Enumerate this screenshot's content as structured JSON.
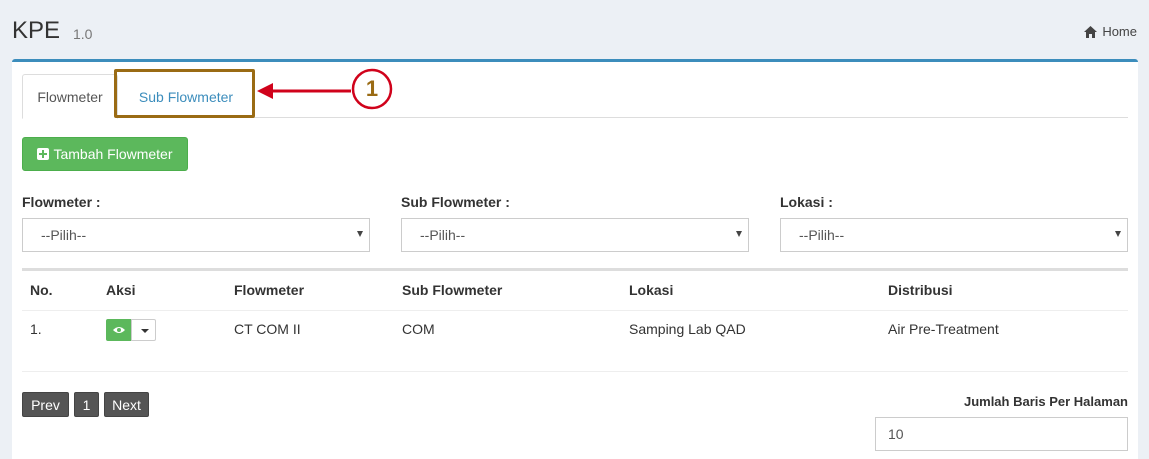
{
  "header": {
    "brand": "KPE",
    "version": "1.0",
    "home_label": "Home"
  },
  "tabs": [
    {
      "label": "Flowmeter",
      "active": true
    },
    {
      "label": "Sub Flowmeter",
      "active": false
    }
  ],
  "annotation": {
    "number": "1",
    "color": "#9a6b14",
    "arrow_color": "#d0021b"
  },
  "add_button": {
    "label": "Tambah Flowmeter",
    "icon": "plus-square-icon"
  },
  "filters": [
    {
      "label": "Flowmeter :",
      "value": "--Pilih--"
    },
    {
      "label": "Sub Flowmeter :",
      "value": "--Pilih--"
    },
    {
      "label": "Lokasi :",
      "value": "--Pilih--"
    }
  ],
  "table": {
    "columns": [
      "No.",
      "Aksi",
      "Flowmeter",
      "Sub Flowmeter",
      "Lokasi",
      "Distribusi"
    ],
    "rows": [
      {
        "no": "1.",
        "flowmeter": "CT COM II",
        "sub_flowmeter": "COM",
        "lokasi": "Samping Lab QAD",
        "distribusi": "Air Pre-Treatment"
      }
    ]
  },
  "pagination": {
    "prev": "Prev",
    "page": "1",
    "next": "Next"
  },
  "rows_per_page": {
    "label": "Jumlah Baris Per Halaman",
    "value": "10"
  },
  "colors": {
    "accent": "#3c8dbc",
    "success": "#5cb85c",
    "pager": "#555555"
  }
}
